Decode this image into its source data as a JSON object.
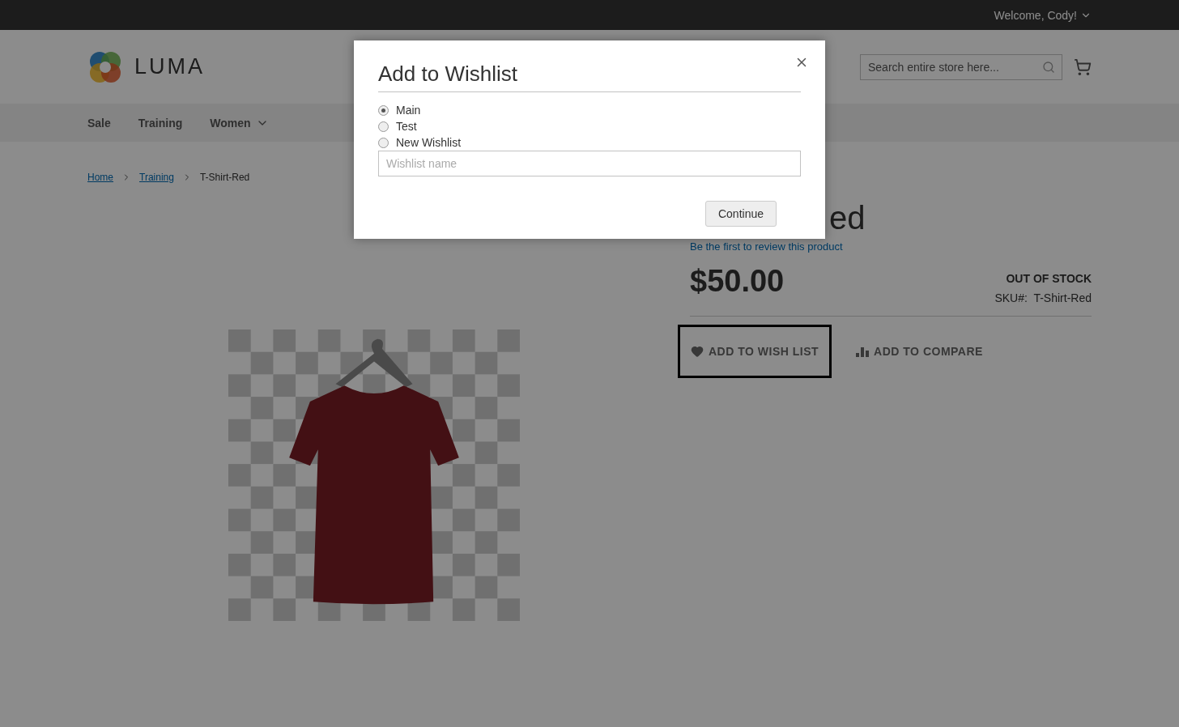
{
  "header": {
    "welcome": "Welcome, Cody!",
    "logo_text": "LUMA",
    "search": {
      "placeholder": "Search entire store here..."
    }
  },
  "nav": [
    {
      "label": "Sale",
      "dropdown": false
    },
    {
      "label": "Training",
      "dropdown": false
    },
    {
      "label": "Women",
      "dropdown": true
    }
  ],
  "breadcrumbs": [
    {
      "label": "Home",
      "link": true
    },
    {
      "label": "Training",
      "link": true
    },
    {
      "label": "T-Shirt-Red",
      "link": false
    }
  ],
  "product": {
    "title": "ed",
    "review_link": "Be the first to review this product",
    "price": "$50.00",
    "stock": "OUT OF STOCK",
    "sku_label": "SKU#:",
    "sku": "T-Shirt-Red",
    "actions": [
      {
        "label": "ADD TO WISH LIST",
        "kind": "wishlist",
        "focused": true
      },
      {
        "label": "ADD TO COMPARE",
        "kind": "compare",
        "focused": false
      }
    ]
  },
  "modal": {
    "title": "Add to Wishlist",
    "options": [
      {
        "label": "Main",
        "selected": true
      },
      {
        "label": "Test",
        "selected": false
      },
      {
        "label": "New Wishlist",
        "selected": false
      }
    ],
    "name_field": {
      "placeholder": "Wishlist name"
    },
    "button": "Continue"
  }
}
